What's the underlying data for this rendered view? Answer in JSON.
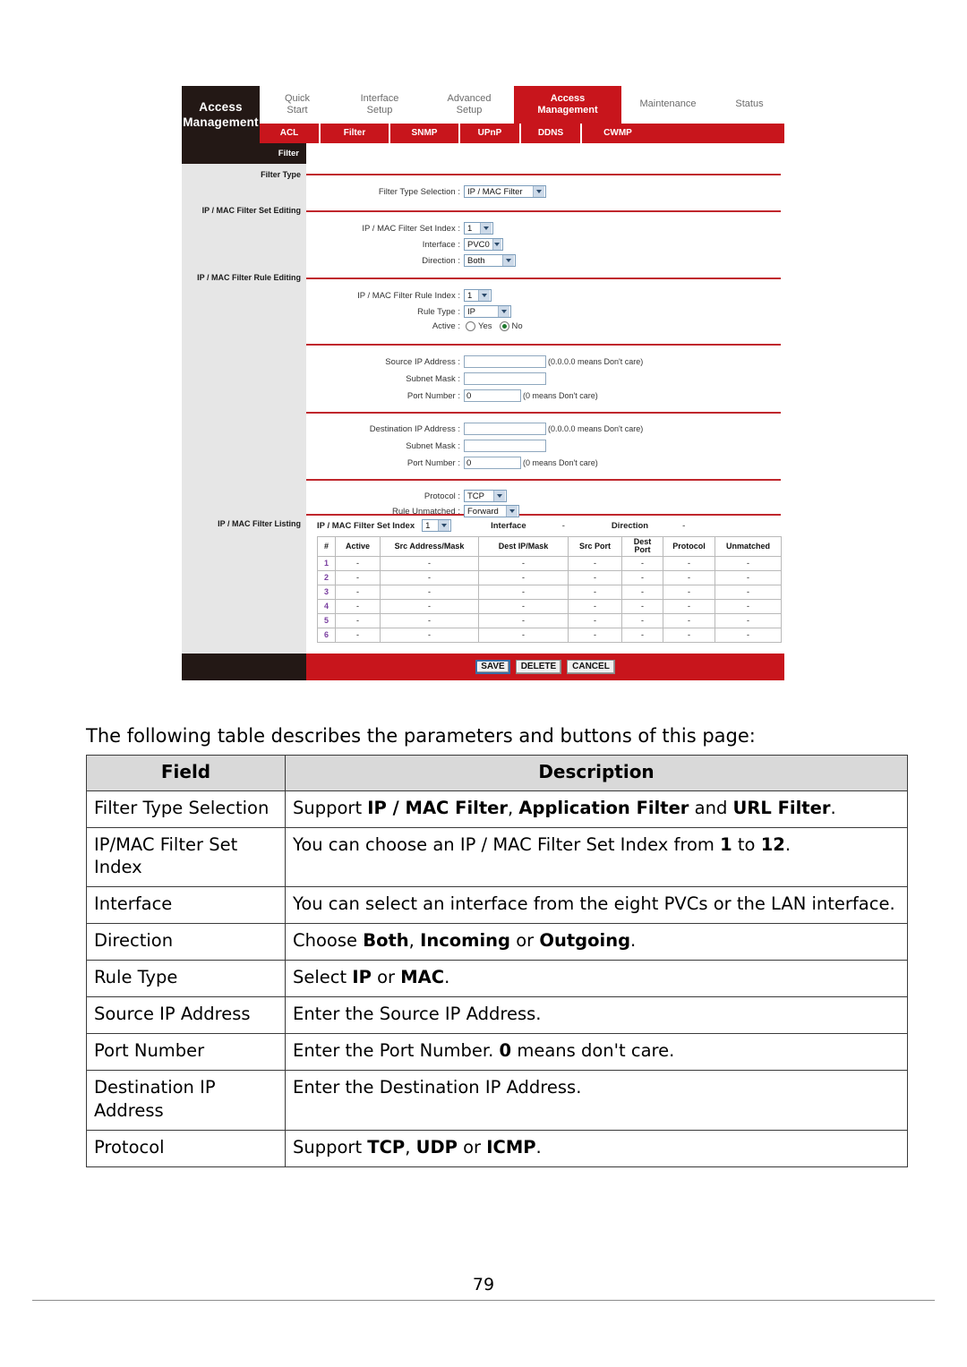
{
  "router": {
    "brand_title": "Access\nManagement",
    "brand_line1": "Access",
    "brand_line2": "Management",
    "main_tabs": [
      {
        "line1": "Quick",
        "line2": "Start",
        "active": false
      },
      {
        "line1": "Interface",
        "line2": "Setup",
        "active": false
      },
      {
        "line1": "Advanced",
        "line2": "Setup",
        "active": false
      },
      {
        "line1": "Access",
        "line2": "Management",
        "active": true
      },
      {
        "line1": "Maintenance",
        "line2": "",
        "active": false
      },
      {
        "line1": "Status",
        "line2": "",
        "active": false
      }
    ],
    "sub_tabs": [
      "ACL",
      "Filter",
      "SNMP",
      "UPnP",
      "DDNS",
      "CWMP"
    ],
    "panel_title": "Filter",
    "section_labels": [
      "Filter Type",
      "IP / MAC Filter Set Editing",
      "IP / MAC Filter Rule Editing",
      "IP / MAC Filter Listing"
    ],
    "fields": {
      "filter_type_selection_label": "Filter Type Selection :",
      "filter_type_selection_value": "IP / MAC Filter",
      "set_index_label": "IP / MAC Filter Set Index :",
      "set_index_value": "1",
      "interface_label": "Interface :",
      "interface_value": "PVC0",
      "direction_label": "Direction :",
      "direction_value": "Both",
      "rule_index_label": "IP / MAC Filter Rule Index :",
      "rule_index_value": "1",
      "rule_type_label": "Rule Type :",
      "rule_type_value": "IP",
      "active_label": "Active :",
      "active_yes": "Yes",
      "active_no": "No",
      "src_ip_label": "Source IP Address :",
      "src_ip_value": "",
      "src_ip_hint": "(0.0.0.0 means Don't care)",
      "src_mask_label": "Subnet Mask :",
      "src_mask_value": "",
      "src_port_label": "Port Number :",
      "src_port_value": "0",
      "src_port_hint": "(0 means Don't care)",
      "dst_ip_label": "Destination IP Address :",
      "dst_ip_value": "",
      "dst_ip_hint": "(0.0.0.0 means Don't care)",
      "dst_mask_label": "Subnet Mask :",
      "dst_mask_value": "",
      "dst_port_label": "Port Number :",
      "dst_port_value": "0",
      "dst_port_hint": "(0 means Don't care)",
      "protocol_label": "Protocol :",
      "protocol_value": "TCP",
      "rule_unmatched_label": "Rule Unmatched :",
      "rule_unmatched_value": "Forward"
    },
    "listing": {
      "set_index_label": "IP / MAC Filter Set Index",
      "set_index_value": "1",
      "interface_label": "Interface",
      "interface_value": "-",
      "direction_label": "Direction",
      "direction_value": "-",
      "columns": [
        "#",
        "Active",
        "Src Address/Mask",
        "Dest IP/Mask",
        "Src Port",
        "Dest\nPort",
        "Protocol",
        "Unmatched"
      ],
      "rows": [
        [
          "1",
          "-",
          "-",
          "-",
          "-",
          "-",
          "-",
          "-"
        ],
        [
          "2",
          "-",
          "-",
          "-",
          "-",
          "-",
          "-",
          "-"
        ],
        [
          "3",
          "-",
          "-",
          "-",
          "-",
          "-",
          "-",
          "-"
        ],
        [
          "4",
          "-",
          "-",
          "-",
          "-",
          "-",
          "-",
          "-"
        ],
        [
          "5",
          "-",
          "-",
          "-",
          "-",
          "-",
          "-",
          "-"
        ],
        [
          "6",
          "-",
          "-",
          "-",
          "-",
          "-",
          "-",
          "-"
        ]
      ]
    },
    "buttons": [
      "SAVE",
      "DELETE",
      "CANCEL"
    ],
    "colors": {
      "red": "#C8151C",
      "dark": "#231815",
      "rule_red": "#C0272D",
      "panel_gray": "#E6E6E6"
    }
  },
  "document": {
    "intro": "The following table describes the parameters and buttons of this page:",
    "table_headers": [
      "Field",
      "Description"
    ],
    "rows": [
      {
        "field": "Filter Type Selection",
        "desc_html": "Support <b>IP / MAC Filter</b>, <b>Application Filter</b> and <b>URL Filter</b>."
      },
      {
        "field": "IP/MAC Filter Set Index",
        "desc_html": "You can choose an IP / MAC Filter Set Index from <b>1</b> to <b>12</b>."
      },
      {
        "field": "Interface",
        "desc_html": "You can select an interface from the eight PVCs or the LAN interface."
      },
      {
        "field": "Direction",
        "desc_html": "Choose <b>Both</b>, <b>Incoming</b> or <b>Outgoing</b>."
      },
      {
        "field": "Rule Type",
        "desc_html": "Select <b>IP</b> or <b>MAC</b>."
      },
      {
        "field": "Source IP Address",
        "desc_html": "Enter the Source IP Address."
      },
      {
        "field": "Port Number",
        "desc_html": "Enter the Port Number. <b>0</b> means don't care."
      },
      {
        "field": "Destination IP Address",
        "desc_html": "Enter the Destination IP Address."
      },
      {
        "field": "Protocol",
        "desc_html": "Support <b>TCP</b>, <b>UDP</b> or <b>ICMP</b>."
      }
    ],
    "page_number": "79"
  }
}
